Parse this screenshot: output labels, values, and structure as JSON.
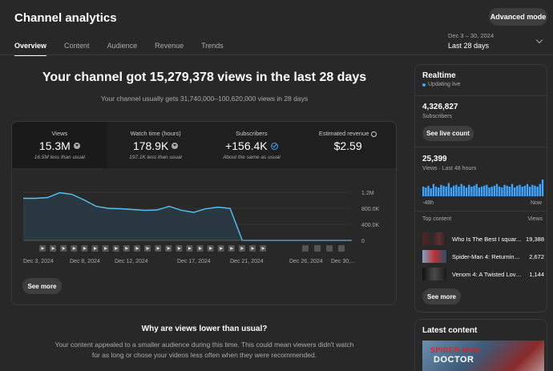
{
  "header": {
    "title": "Channel analytics",
    "advanced_label": "Advanced mode",
    "tabs": [
      {
        "label": "Overview",
        "active": true
      },
      {
        "label": "Content",
        "active": false
      },
      {
        "label": "Audience",
        "active": false
      },
      {
        "label": "Revenue",
        "active": false
      },
      {
        "label": "Trends",
        "active": false
      }
    ],
    "date_range": "Dec 3 – 30, 2024",
    "period": "Last 28 days"
  },
  "summary": {
    "headline": "Your channel got 15,279,378 views in the last 28 days",
    "subline": "Your channel usually gets 31,740,000–100,620,000 views in 28 days"
  },
  "metrics": [
    {
      "label": "Views",
      "value": "15.3M",
      "note": "16.5M less than usual",
      "status": "down"
    },
    {
      "label": "Watch time (hours)",
      "value": "178.9K",
      "note": "197.1K less than usual",
      "status": "down"
    },
    {
      "label": "Subscribers",
      "value": "+156.4K",
      "note": "About the same as usual",
      "status": "same"
    },
    {
      "label": "Estimated revenue",
      "value": "$2.59",
      "note": "",
      "status": "clock"
    }
  ],
  "chart_data": {
    "type": "area",
    "x": [
      "Dec 3",
      "Dec 4",
      "Dec 5",
      "Dec 6",
      "Dec 7",
      "Dec 8",
      "Dec 9",
      "Dec 10",
      "Dec 11",
      "Dec 12",
      "Dec 13",
      "Dec 14",
      "Dec 15",
      "Dec 16",
      "Dec 17",
      "Dec 18",
      "Dec 19",
      "Dec 20",
      "Dec 21",
      "Dec 22",
      "Dec 23",
      "Dec 24",
      "Dec 25",
      "Dec 26",
      "Dec 27",
      "Dec 28",
      "Dec 29",
      "Dec 30"
    ],
    "series": [
      {
        "values": [
          1050000,
          1050000,
          1070000,
          1190000,
          1150000,
          1010000,
          850000,
          800000,
          790000,
          770000,
          750000,
          760000,
          850000,
          750000,
          700000,
          790000,
          830000,
          800000,
          0,
          0,
          0,
          0,
          0,
          0,
          0,
          0,
          0,
          0
        ]
      }
    ],
    "ylim": [
      0,
      1200000
    ],
    "yticks": [
      "1.2M",
      "800.0K",
      "400.0K",
      "0"
    ],
    "xticks": [
      "Dec 3, 2024",
      "Dec 8, 2024",
      "Dec 12, 2024",
      "Dec 17, 2024",
      "Dec 21, 2024",
      "Dec 26, 2024",
      "Dec 30,..."
    ],
    "color": "#4fc3f7"
  },
  "see_more_label": "See more",
  "why": {
    "title": "Why are views lower than usual?",
    "text": "Your content appealed to a smaller audience during this time. This could mean viewers didn't watch for as long or chose your videos less often when they were recommended."
  },
  "realtime": {
    "title": "Realtime",
    "status": "Updating live",
    "subscribers": "4,326,827",
    "subscribers_label": "Subscribers",
    "live_count_label": "See live count",
    "views": "25,399",
    "views_label": "Views · Last 48 hours",
    "bars": [
      0.55,
      0.5,
      0.6,
      0.45,
      0.7,
      0.55,
      0.5,
      0.65,
      0.6,
      0.55,
      0.75,
      0.5,
      0.6,
      0.65,
      0.55,
      0.7,
      0.6,
      0.5,
      0.65,
      0.55,
      0.6,
      0.7,
      0.5,
      0.55,
      0.6,
      0.65,
      0.5,
      0.55,
      0.6,
      0.7,
      0.55,
      0.5,
      0.65,
      0.6,
      0.55,
      0.7,
      0.5,
      0.6,
      0.65,
      0.55,
      0.6,
      0.7,
      0.55,
      0.65,
      0.6,
      0.55,
      0.7,
      0.95
    ],
    "axis_start": "-48h",
    "axis_end": "Now",
    "top_content_label": "Top content",
    "views_col_label": "Views",
    "top_content": [
      {
        "title": "Who Is The Best I squar...",
        "views": "19,388"
      },
      {
        "title": "Spider-Man 4: Returning ...",
        "views": "2,672"
      },
      {
        "title": "Venom 4: A Twisted Love...",
        "views": "1,144"
      }
    ],
    "see_more_label": "See more",
    "accent": "#3ea6ff"
  },
  "latest": {
    "title": "Latest content",
    "thumb_line1": "SPIDER-MAN",
    "thumb_line2": "DOCTOR"
  }
}
